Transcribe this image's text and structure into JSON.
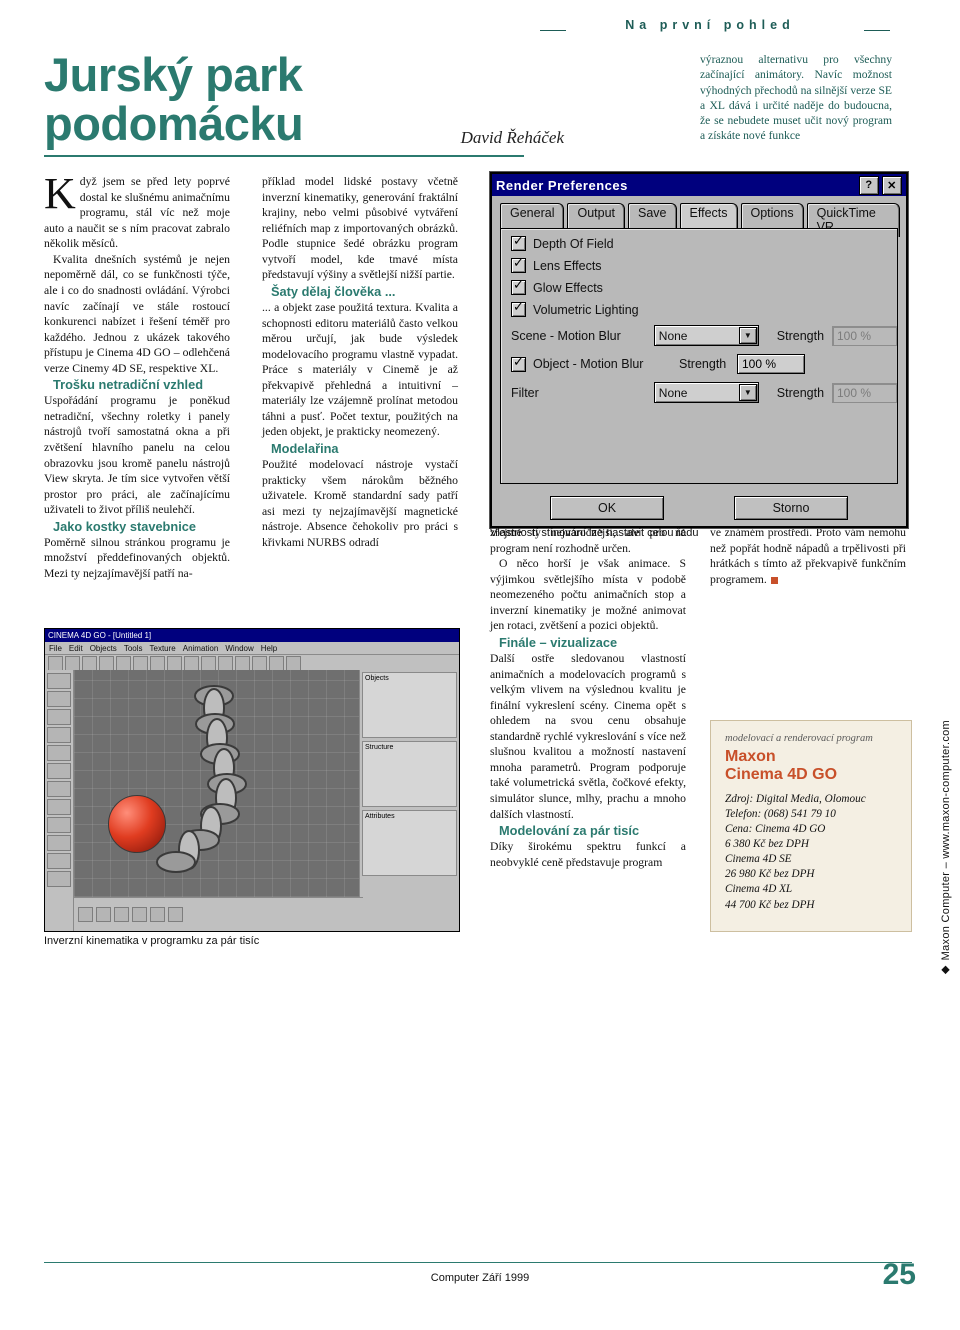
{
  "header": {
    "kicker": "Na první pohled",
    "title": "Jurský park podomácku",
    "author": "David Řeháček",
    "lead": "výraznou alternativu pro všechny začínající animátory. Navíc možnost výhodných přechodů na silnější verze SE a XL dává i určité naděje do budoucna, že se nebudete muset učit nový program a získáte nové funkce"
  },
  "columns": {
    "col1": {
      "dropcap": "K",
      "p1": "dyž jsem se před lety poprvé dostal ke slušnému animačnímu programu, stál víc než moje auto a naučit se s ním pracovat zabralo několik měsíců.",
      "p2": "Kvalita dnešních systémů je nejen nepoměrně dál, co se funkčnosti týče, ale i co do snadnosti ovládání. Výrobci navíc začínají ve stále rostoucí konkurenci nabízet i řešení téměř pro každého. Jednou z ukázek takového přístupu je Cinema 4D GO – odlehčená verze Cinemy 4D SE, respektive XL.",
      "sub1": "Trošku netradiční vzhled",
      "p3": "Uspořádání programu je poněkud netradiční, všechny roletky i panely nástrojů tvoří samostatná okna a při zvětšení hlavního panelu na celou obrazovku jsou kromě panelu nástrojů View skryta. Je tím sice vytvořen větší prostor pro práci, ale začínajícímu uživateli to život příliš neulehčí.",
      "sub2": "Jako kostky stavebnice",
      "p4": "Poměrně silnou stránkou programu je množství předdefinovaných objektů. Mezi ty nejzajímavější patří na-"
    },
    "col2": {
      "p1": "příklad model lidské postavy včetně inverzní kinematiky, generování fraktální krajiny, nebo velmi působivé vytváření reliéfních map z importovaných obrázků. Podle stupnice šedé obrázku program vytvoří model, kde tmavé místa představují výšiny a světlejší nižší partie.",
      "sub1": "Šaty dělaj člověka ...",
      "p2": "... a objekt zase použitá textura. Kvalita a schopnosti editoru materiálů často velkou měrou určují, jak bude výsledek modelovacího programu vlastně vypadat. Práce s materiály v Cinemě je až překvapivě přehledná a intuitivní – materiály lze vzájemně prolínat metodou táhni a pusť. Počet textur, použitých na jeden objekt, je prakticky neomezený.",
      "sub2": "Modelařina",
      "p3": "Použité modelovací nástroje vystačí prakticky všem nárokům běžného uživatele. Kromě standardní sady patří asi mezi ty nejzajímavější magnetické nástroje. Absence čehokoliv pro práci s křivkami NURBS odradí"
    },
    "col3": {
      "p1": "zřejmě ty nejnáročnější, ale pro ně program není rozhodně určen.",
      "p2": "O něco horší je však animace. S výjimkou světlejšího místa v podobě neomezeného počtu animačních stop a inverzní kinematiky je možné animovat jen rotaci, zvětšení a pozici objektů.",
      "sub1": "Finále – vizualizace",
      "p3": "Další ostře sledovanou vlastností animačních a modelovacích programů s velkým vlivem na výslednou kvalitu je finální vykreslení scény. Cinema opět s ohledem na svou cenu obsahuje standardně rychlé vykreslování s více než slušnou kvalitou a možností nastavení mnoha parametrů. Program podporuje také volumetrická světla, čočkové efekty, simulátor slunce, mlhy, prachu a mnoho dalších vlastností.",
      "sub2": "Modelování za pár tisíc",
      "p4": "Díky širokému spektru funkcí a neobvyklé ceně představuje program"
    },
    "col4": {
      "p1": "ve známém prostředí. Proto vám nemohu než popřát hodně nápadů a trpělivosti při hrátkách s tímto až překvapivě funkčním programem."
    }
  },
  "dialog": {
    "title": "Render Preferences",
    "help_button": "?",
    "close_button": "✕",
    "tabs": [
      {
        "label": "General",
        "active": false
      },
      {
        "label": "Output",
        "active": false
      },
      {
        "label": "Save",
        "active": false
      },
      {
        "label": "Effects",
        "active": true
      },
      {
        "label": "Options",
        "active": false
      },
      {
        "label": "QuickTime VR",
        "active": false
      }
    ],
    "checkboxes": [
      {
        "label": "Depth Of Field",
        "checked": true
      },
      {
        "label": "Lens Effects",
        "checked": true
      },
      {
        "label": "Glow Effects",
        "checked": true
      },
      {
        "label": "Volumetric Lighting",
        "checked": true
      }
    ],
    "rows": [
      {
        "label": "Scene - Motion Blur",
        "checked": false,
        "value": "None",
        "strength_label": "Strength",
        "strength_value": "100 %",
        "strength_enabled": false
      },
      {
        "label": "Object - Motion Blur",
        "checked": true,
        "value": "",
        "strength_label": "Strength",
        "strength_value": "100 %",
        "strength_enabled": true
      },
      {
        "label": "Filter",
        "checked": false,
        "value": "None",
        "strength_label": "Strength",
        "strength_value": "100 %",
        "strength_enabled": false
      }
    ],
    "ok_label": "OK",
    "cancel_label": "Storno",
    "caption": "Vlastností stínování lze nastavit celou řadu"
  },
  "screenshot": {
    "title": "CINEMA 4D GO - [Untitled 1]",
    "menu": [
      "File",
      "Edit",
      "Objects",
      "Tools",
      "Texture",
      "Animation",
      "Window",
      "Help"
    ],
    "right_panels": [
      "Objects",
      "Structure",
      "Attributes"
    ],
    "caption": "Inverzní kinematika v programku za pár tisíc"
  },
  "infobox": {
    "kicker": "modelovací a renderovací program",
    "brand_line1": "Maxon",
    "brand_line2": "Cinema 4D GO",
    "lines": [
      "Zdroj: Digital Media, Olomouc",
      "Telefon: (068) 541 79 10",
      "Cena: Cinema 4D GO",
      "6 380 Kč bez DPH",
      "Cinema 4D SE",
      "26 980 Kč bez DPH",
      "Cinema 4D XL",
      "44 700 Kč bez DPH"
    ]
  },
  "sidetext": "◆ Maxon Computer – www.maxon-computer.com",
  "footer": {
    "note": "Computer Září 1999",
    "page": "25"
  }
}
